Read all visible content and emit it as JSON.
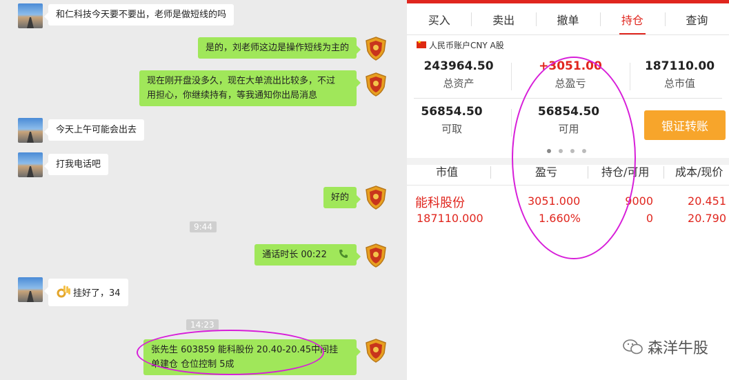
{
  "chat": {
    "messages": [
      {
        "side": "left",
        "text": "和仁科技今天要不要出，老师是做短线的吗"
      },
      {
        "side": "right",
        "text": "是的，刘老师这边是操作短线为主的"
      },
      {
        "side": "right",
        "line1": "现在刚开盘没多久，现在大单流出比较多，不过",
        "line2": "用担心，你继续持有，等我通知你出局消息"
      },
      {
        "side": "left",
        "text": "今天上午可能会出去"
      },
      {
        "side": "left",
        "text": "打我电话吧"
      },
      {
        "side": "right",
        "text": "好的"
      },
      {
        "side": "right",
        "text": "通话时长 00:22",
        "icon": "phone-icon"
      },
      {
        "side": "left",
        "text": "挂好了，34",
        "icon": "ok-hand-emoji-icon"
      },
      {
        "side": "right",
        "line1": "张先生 603859 能科股份   20.40-20.45中间挂",
        "line2": "单建仓 仓位控制 5成"
      }
    ],
    "timestamps": [
      "9:44",
      "14:23"
    ]
  },
  "trade": {
    "tabs": [
      {
        "label": "买入",
        "active": false
      },
      {
        "label": "卖出",
        "active": false
      },
      {
        "label": "撤单",
        "active": false
      },
      {
        "label": "持仓",
        "active": true
      },
      {
        "label": "查询",
        "active": false
      }
    ],
    "account_label": "人民币账户CNY A股",
    "summary": {
      "total_assets": {
        "value": "243964.50",
        "label": "总资产"
      },
      "total_pnl": {
        "value": "+3051.00",
        "label": "总盈亏"
      },
      "total_market_value": {
        "value": "187110.00",
        "label": "总市值"
      },
      "withdrawable": {
        "value": "56854.50",
        "label": "可取"
      },
      "available": {
        "value": "56854.50",
        "label": "可用"
      }
    },
    "transfer_button": "银证转账",
    "table_headers": [
      "市值",
      "盈亏",
      "持仓/可用",
      "成本/现价"
    ],
    "positions": [
      {
        "name": "能科股份",
        "market_value": "187110.000",
        "pnl": "3051.000",
        "pnl_pct": "1.660%",
        "holding": "9000",
        "available": "0",
        "cost": "20.451",
        "price": "20.790"
      }
    ],
    "colors": {
      "accent": "#e0261e",
      "button": "#f7a52b",
      "annotation": "#d71ed9",
      "bubble_green": "#a0e75a"
    }
  },
  "watermark": "森洋牛股"
}
